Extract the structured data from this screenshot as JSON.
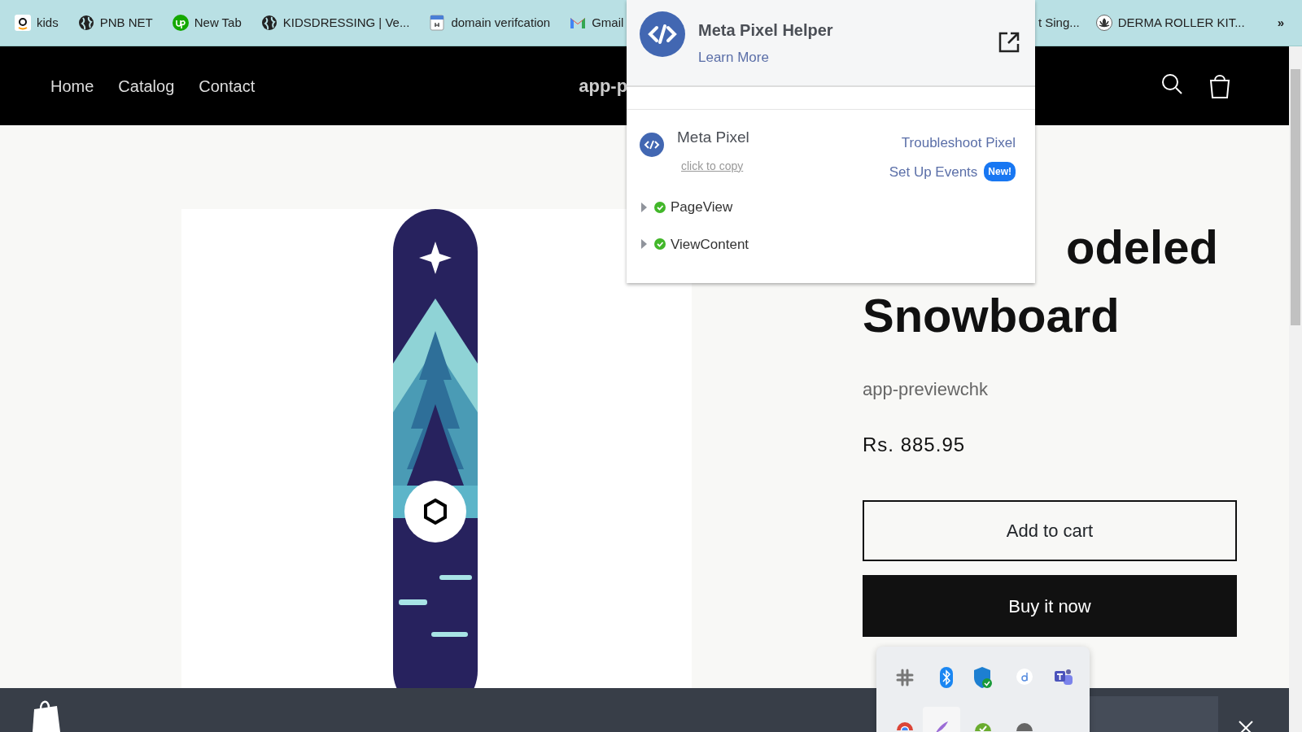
{
  "bookmarks": [
    {
      "label": "kids",
      "kind": "amazon"
    },
    {
      "label": "PNB NET",
      "kind": "globe"
    },
    {
      "label": "New Tab",
      "kind": "upwork"
    },
    {
      "label": "KIDSDRESSING | Ve...",
      "kind": "globe"
    },
    {
      "label": "domain verifcation",
      "kind": "doc"
    },
    {
      "label": "Gmail",
      "kind": "gmail"
    }
  ],
  "bookmarks_right": [
    {
      "label": "t Sing...",
      "kind": "none"
    },
    {
      "label": "DERMA ROLLER KIT...",
      "kind": "lotus"
    }
  ],
  "bookmarks_more": "»",
  "store_nav": {
    "links": [
      "Home",
      "Catalog",
      "Contact"
    ],
    "store_name": "app-p"
  },
  "product": {
    "title_lines": [
      "odeled",
      "Snowboard"
    ],
    "vendor": "app-previewchk",
    "price": "Rs. 885.95",
    "add_to_cart": "Add to cart",
    "buy_now": "Buy it now"
  },
  "pixel_helper": {
    "title": "Meta Pixel Helper",
    "learn_more": "Learn More",
    "pixel_name": "Meta Pixel",
    "copy_hint": "click to copy",
    "troubleshoot": "Troubleshoot Pixel",
    "setup_events": "Set Up Events",
    "badge": "New!",
    "events": [
      {
        "name": "PageView",
        "expanded": false,
        "success": true
      },
      {
        "name": "ViewContent",
        "expanded": false,
        "success": true
      }
    ]
  }
}
